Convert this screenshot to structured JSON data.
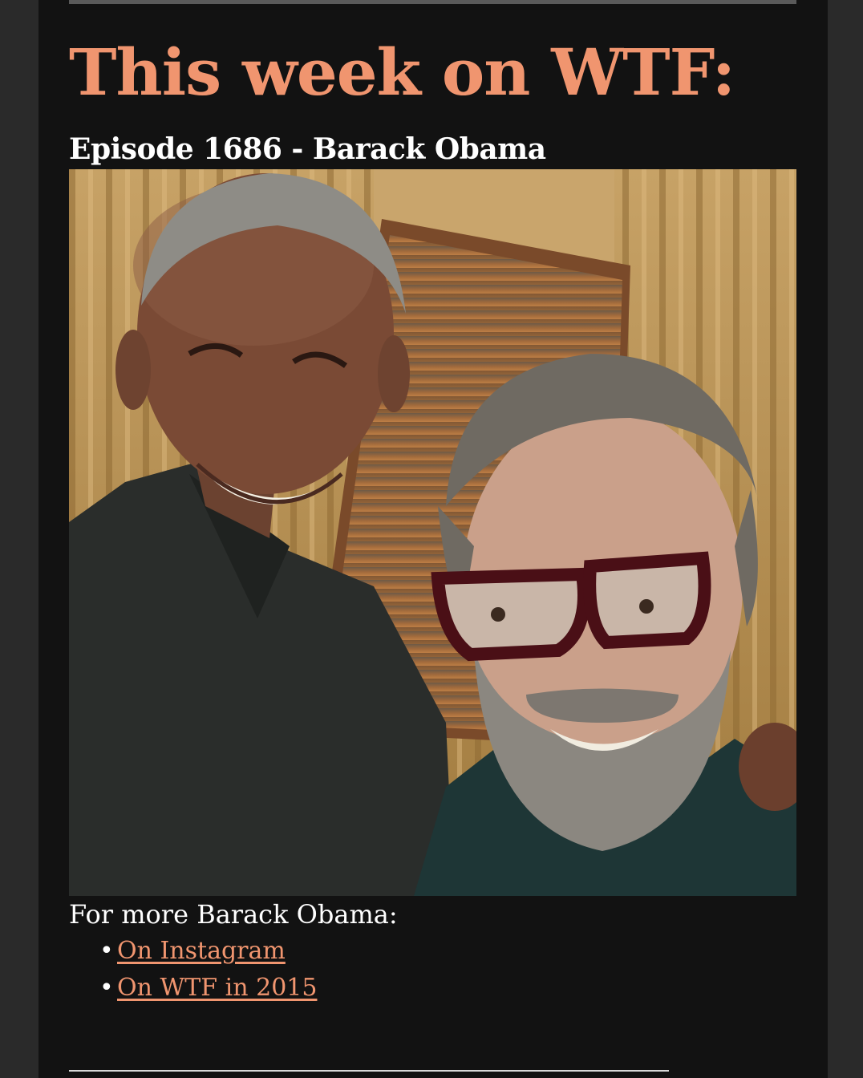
{
  "headline": "This week on WTF:",
  "episode_title": "Episode 1686 - Barack Obama",
  "photo": {
    "alt": "Barack Obama and Marc Maron selfie"
  },
  "more": {
    "label": "For more Barack Obama:",
    "links": [
      {
        "bullet": "•",
        "label": "On Instagram"
      },
      {
        "bullet": "•",
        "label": "On WTF in 2015"
      }
    ]
  },
  "colors": {
    "accent": "#f0956f",
    "text": "#ffffff",
    "background": "#121212",
    "outer": "#2a2a2a"
  }
}
